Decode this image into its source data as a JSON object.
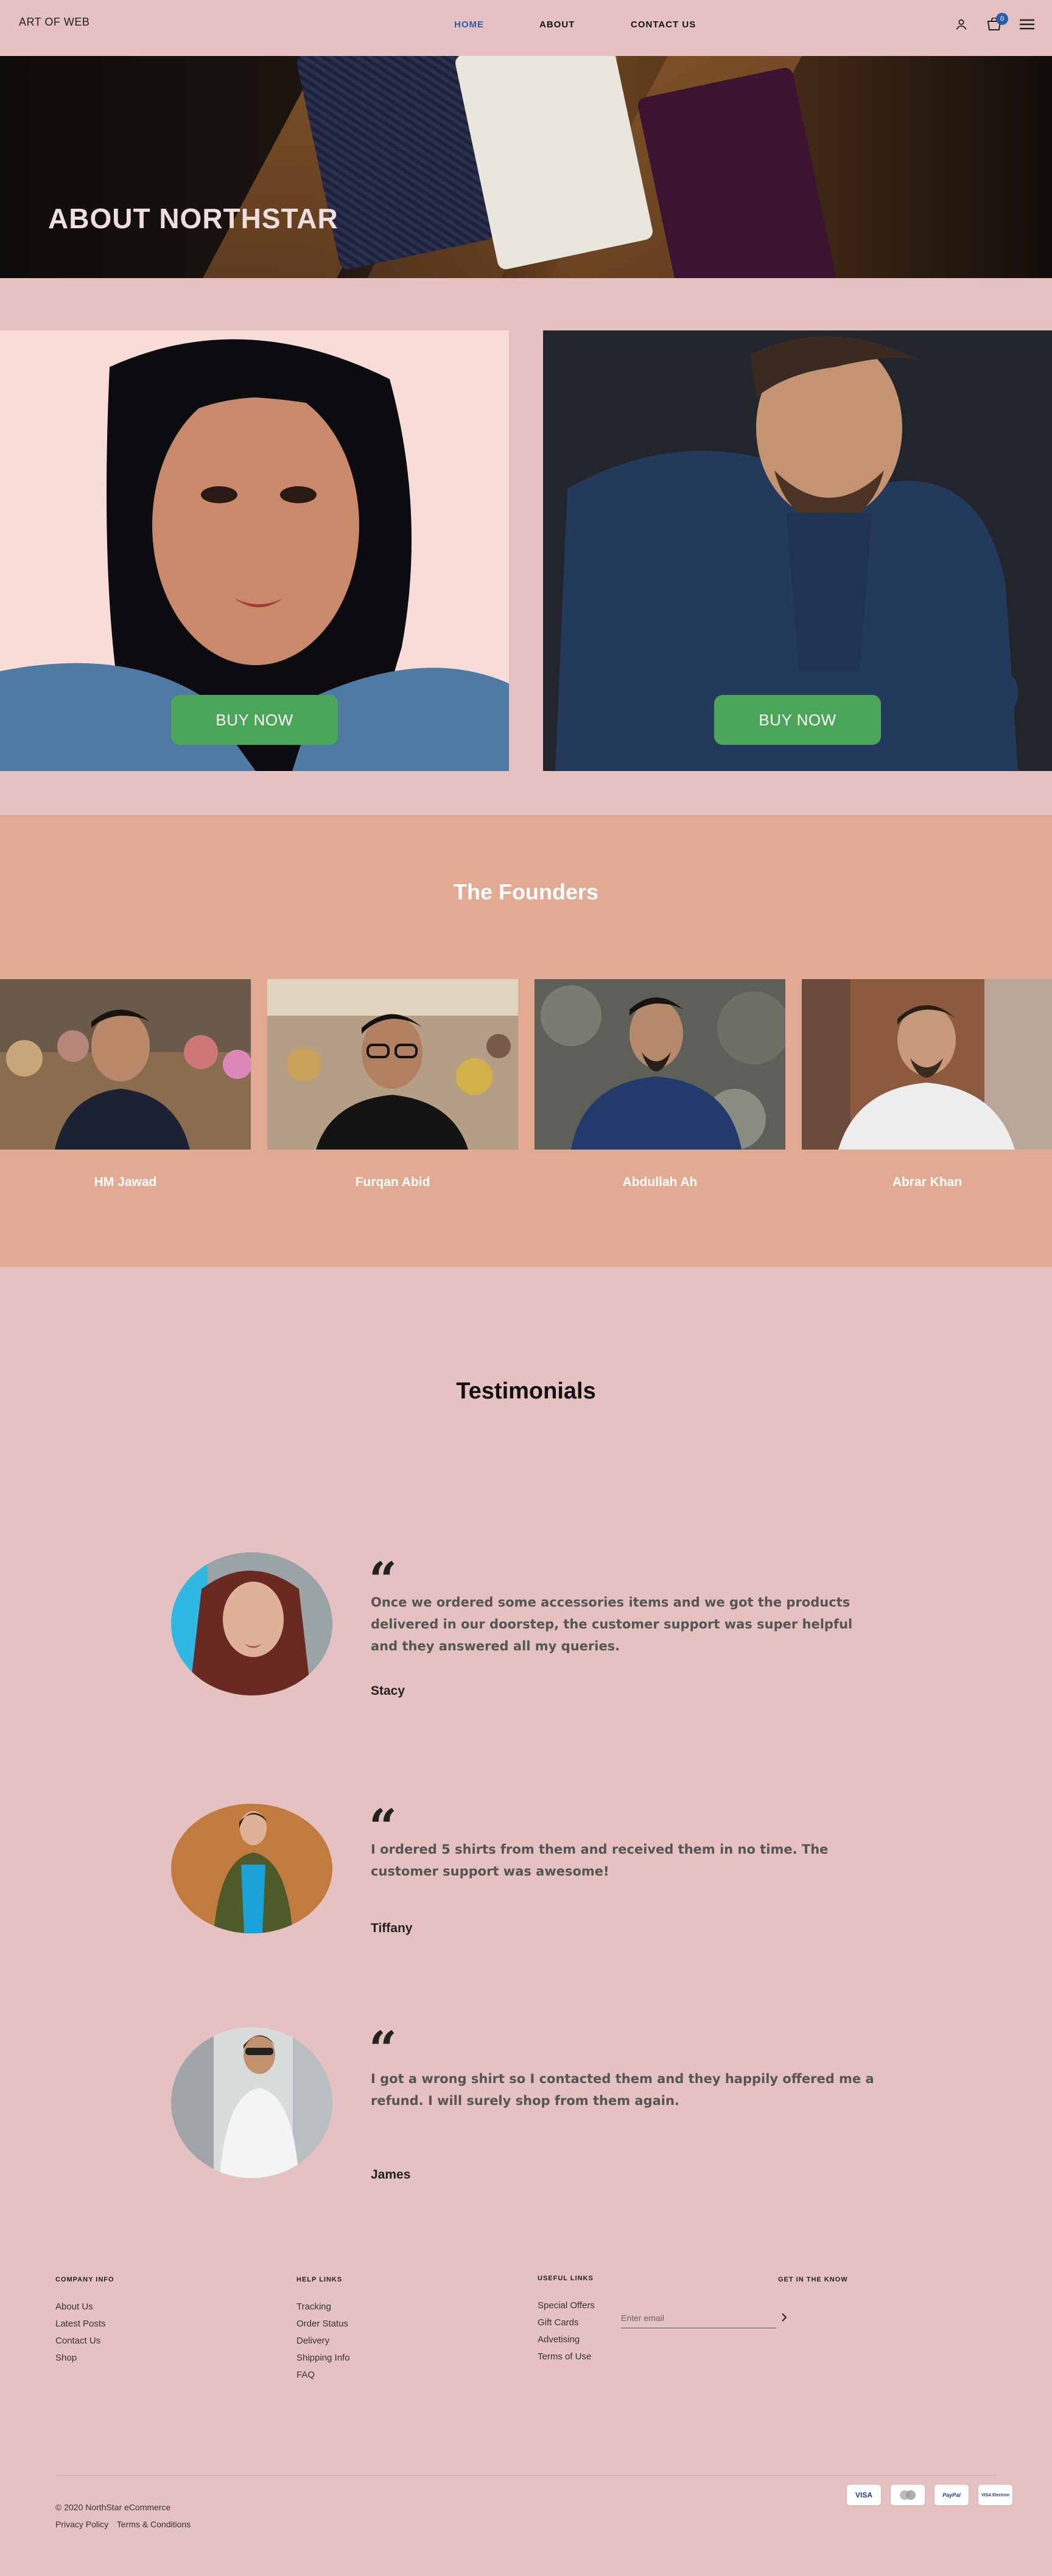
{
  "nav": {
    "brand": "ART OF WEB",
    "links": [
      {
        "label": "HOME",
        "active": true
      },
      {
        "label": "ABOUT",
        "active": false
      },
      {
        "label": "CONTACT US",
        "active": false
      }
    ],
    "icons": [
      "user-icon",
      "cart-icon",
      "menu-icon"
    ],
    "cart_count": "0"
  },
  "hero": {
    "title": "ABOUT NORTHSTAR"
  },
  "banners": [
    {
      "button_label": "BUY NOW"
    },
    {
      "button_label": "BUY NOW"
    }
  ],
  "founders": {
    "title": "The Founders",
    "people": [
      {
        "name": "HM Jawad"
      },
      {
        "name": "Furqan Abid"
      },
      {
        "name": "Abdullah Ah"
      },
      {
        "name": "Abrar Khan"
      }
    ]
  },
  "testimonials": {
    "title": "Testimonials",
    "items": [
      {
        "quote": "Once we ordered some accessories items and we got the products delivered in our doorstep, the customer support was super helpful and they answered all my queries.",
        "author": "Stacy"
      },
      {
        "quote": "I ordered 5 shirts from them and received them in no time. The customer support was awesome!",
        "author": "Tiffany"
      },
      {
        "quote": "I got a wrong shirt so I contacted them and they happily offered me a refund. I will surely shop from them again.",
        "author": "James"
      }
    ]
  },
  "footer": {
    "company_info": {
      "heading": "COMPANY INFO",
      "links": [
        "About Us",
        "Latest Posts",
        "Contact Us",
        "Shop"
      ]
    },
    "help_links": {
      "heading": "HELP LINKS",
      "links": [
        "Tracking",
        "Order Status",
        "Delivery",
        "Shipping Info",
        "FAQ"
      ]
    },
    "useful_links": {
      "heading": "USEFUL LINKS",
      "links": [
        "Special Offers",
        "Gift Cards",
        "Advetising",
        "Terms of Use"
      ]
    },
    "newsletter": {
      "heading": "GET IN THE KNOW",
      "placeholder": "Enter email"
    },
    "copyright": "© 2020 NorthStar eCommerce",
    "legal": [
      "Privacy Policy",
      "Terms & Conditions"
    ],
    "payments": [
      "VISA",
      "MasterCard",
      "PayPal",
      "VISA Electron"
    ]
  },
  "colors": {
    "page_bg": "#e6c1c1",
    "accent": "#2a5ea8",
    "founders_bg": "#e2aa93",
    "buy_button": "#4ca65a"
  }
}
